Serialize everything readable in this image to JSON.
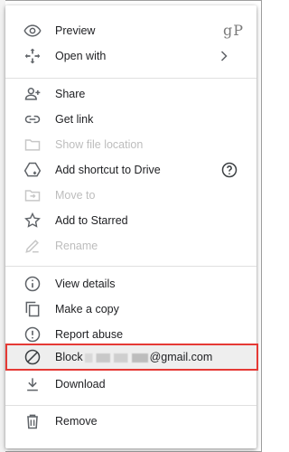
{
  "watermark": "gP",
  "menu": {
    "items": [
      {
        "label": "Preview",
        "icon": "eye-icon"
      },
      {
        "label": "Open with",
        "icon": "move-arrows-icon",
        "trailing": "›"
      },
      {
        "label": "Share",
        "icon": "person-add-icon"
      },
      {
        "label": "Get link",
        "icon": "link-icon"
      },
      {
        "label": "Show file location",
        "icon": "folder-icon",
        "disabled": true
      },
      {
        "label": "Add shortcut to Drive",
        "icon": "drive-shortcut-icon"
      },
      {
        "label": "Move to",
        "icon": "move-to-folder-icon",
        "disabled": true
      },
      {
        "label": "Add to Starred",
        "icon": "star-icon"
      },
      {
        "label": "Rename",
        "icon": "pencil-icon",
        "disabled": true
      },
      {
        "label": "View details",
        "icon": "info-icon"
      },
      {
        "label": "Make a copy",
        "icon": "copy-icon"
      },
      {
        "label": "Report abuse",
        "icon": "report-icon"
      },
      {
        "label_prefix": "Block",
        "label_suffix": "@gmail.com",
        "icon": "block-icon"
      },
      {
        "label": "Download",
        "icon": "download-icon"
      },
      {
        "label": "Remove",
        "icon": "trash-icon"
      }
    ],
    "help_icon": "help-circle-icon"
  },
  "colors": {
    "highlight_border": "#e53935",
    "text": "#202124",
    "disabled_text": "#bdbdbd",
    "icon": "#5f6368"
  }
}
